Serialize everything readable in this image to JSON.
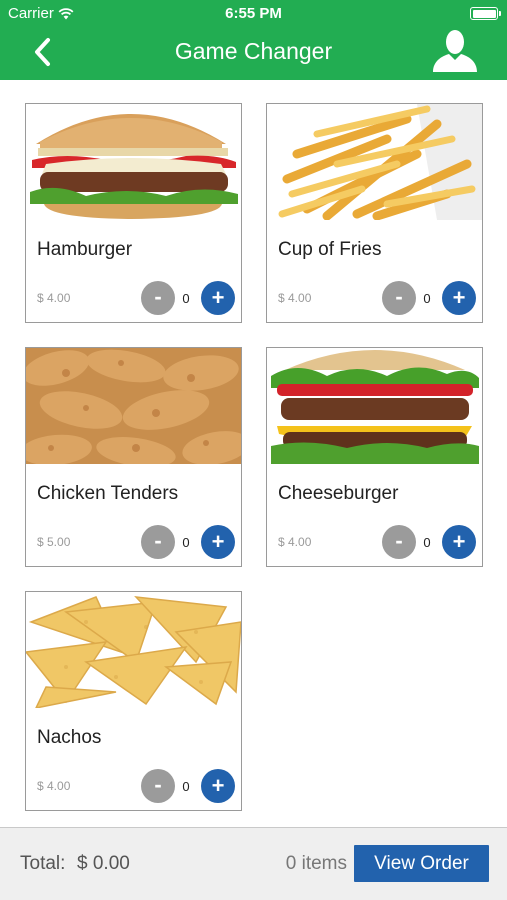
{
  "status_bar": {
    "carrier": "Carrier",
    "time": "6:55 PM",
    "wifi_icon": "wifi-icon",
    "battery_icon": "battery-icon"
  },
  "header": {
    "title": "Game Changer",
    "back_icon": "chevron-left-icon",
    "profile_icon": "user-icon",
    "color": "#22ad52"
  },
  "menu": {
    "items": [
      {
        "name": "Hamburger",
        "price": "$ 4.00",
        "quantity": "0",
        "minus_label": "-",
        "plus_label": "+",
        "image": "hamburger-photo"
      },
      {
        "name": "Cup of Fries",
        "price": "$ 4.00",
        "quantity": "0",
        "minus_label": "-",
        "plus_label": "+",
        "image": "fries-photo"
      },
      {
        "name": "Chicken Tenders",
        "price": "$ 5.00",
        "quantity": "0",
        "minus_label": "-",
        "plus_label": "+",
        "image": "chicken-tenders-photo"
      },
      {
        "name": "Cheeseburger",
        "price": "$ 4.00",
        "quantity": "0",
        "minus_label": "-",
        "plus_label": "+",
        "image": "cheeseburger-photo"
      },
      {
        "name": "Nachos",
        "price": "$ 4.00",
        "quantity": "0",
        "minus_label": "-",
        "plus_label": "+",
        "image": "nachos-photo"
      }
    ]
  },
  "footer": {
    "total_label": "Total:",
    "total_value": "$ 0.00",
    "items_count": "0 items",
    "view_order_label": "View Order",
    "button_color": "#2262ad"
  }
}
